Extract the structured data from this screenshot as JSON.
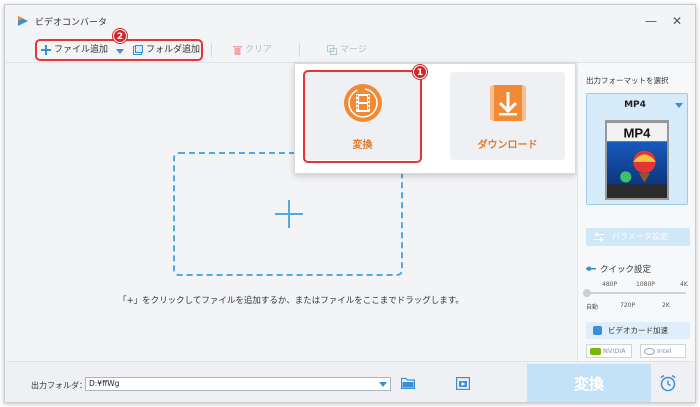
{
  "window": {
    "title": "ビデオコンバータ",
    "logo_icon": "app-logo-icon",
    "controls": {
      "minimize": "—",
      "close": "✕"
    }
  },
  "toolbar": {
    "add_file": "ファイル追加",
    "add_folder": "フォルダ追加",
    "clear": "クリア",
    "merge": "マージ",
    "badge_two": "2"
  },
  "popup": {
    "badge_one": "1",
    "convert_tile": "変換",
    "download_tile": "ダウンロード"
  },
  "main": {
    "hint": "「+」をクリックしてファイルを追加するか、またはファイルをここまでドラッグします。"
  },
  "output_panel": {
    "title": "出力フォーマットを選択",
    "format_name": "MP4",
    "format_art_text": "MP4",
    "param_button": "パラメータ設定",
    "quick_settings_label": "クイック設定",
    "ticks_top": [
      "480P",
      "1080P",
      "4K"
    ],
    "ticks_bottom": [
      "自動",
      "720P",
      "2K"
    ],
    "gpu_button": "ビデオカード加速",
    "gpu_chips": [
      "NVIDIA",
      "Intel"
    ]
  },
  "bottom": {
    "output_label": "出力フォルダ：",
    "output_path": "D:¥ffWg",
    "convert_button": "変換"
  },
  "colors": {
    "accent_blue": "#3b8fd6",
    "highlight_red": "#e23535",
    "tile_orange": "#f08a35",
    "dashed_blue": "#52a8e2"
  }
}
